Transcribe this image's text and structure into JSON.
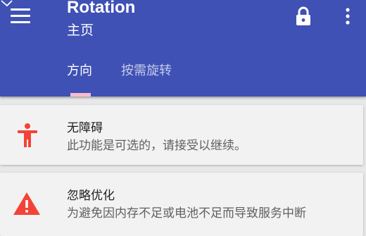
{
  "app": {
    "title": "Rotation",
    "subtitle": "主页",
    "primary_color": "#3f51b5",
    "accent_color": "#f44336"
  },
  "toolbar": {
    "menu_icon": "hamburger-menu-icon",
    "lock_icon": "lock-icon",
    "more_icon": "more-vert-icon"
  },
  "tabs": [
    {
      "label": "方向",
      "active": true
    },
    {
      "label": "按需旋转",
      "active": false
    }
  ],
  "cards": [
    {
      "icon": "accessibility-icon",
      "title": "无障碍",
      "description": "此功能是可选的，请接受以继续。"
    },
    {
      "icon": "warning-icon",
      "title": "忽略优化",
      "description": "为避免因内存不足或电池不足而导致服务中断"
    }
  ]
}
